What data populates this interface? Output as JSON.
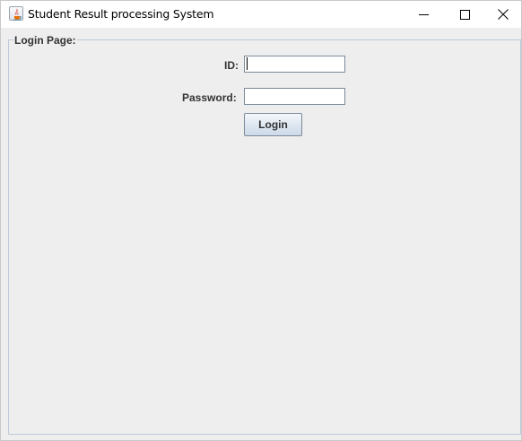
{
  "window": {
    "title": "Student Result processing System",
    "controls": [
      "minimize-icon",
      "maximize-icon",
      "close-icon"
    ]
  },
  "panel": {
    "title": "Login Page:"
  },
  "form": {
    "id_label": "ID:",
    "id_value": "",
    "password_label": "Password:",
    "password_value": "",
    "login_label": "Login"
  },
  "colors": {
    "background": "#eeeeee",
    "titlebar": "#ffffff",
    "group_border": "#bccadb",
    "button_gradient_top": "#f4f7fb",
    "button_gradient_bottom": "#cdd9e8"
  }
}
